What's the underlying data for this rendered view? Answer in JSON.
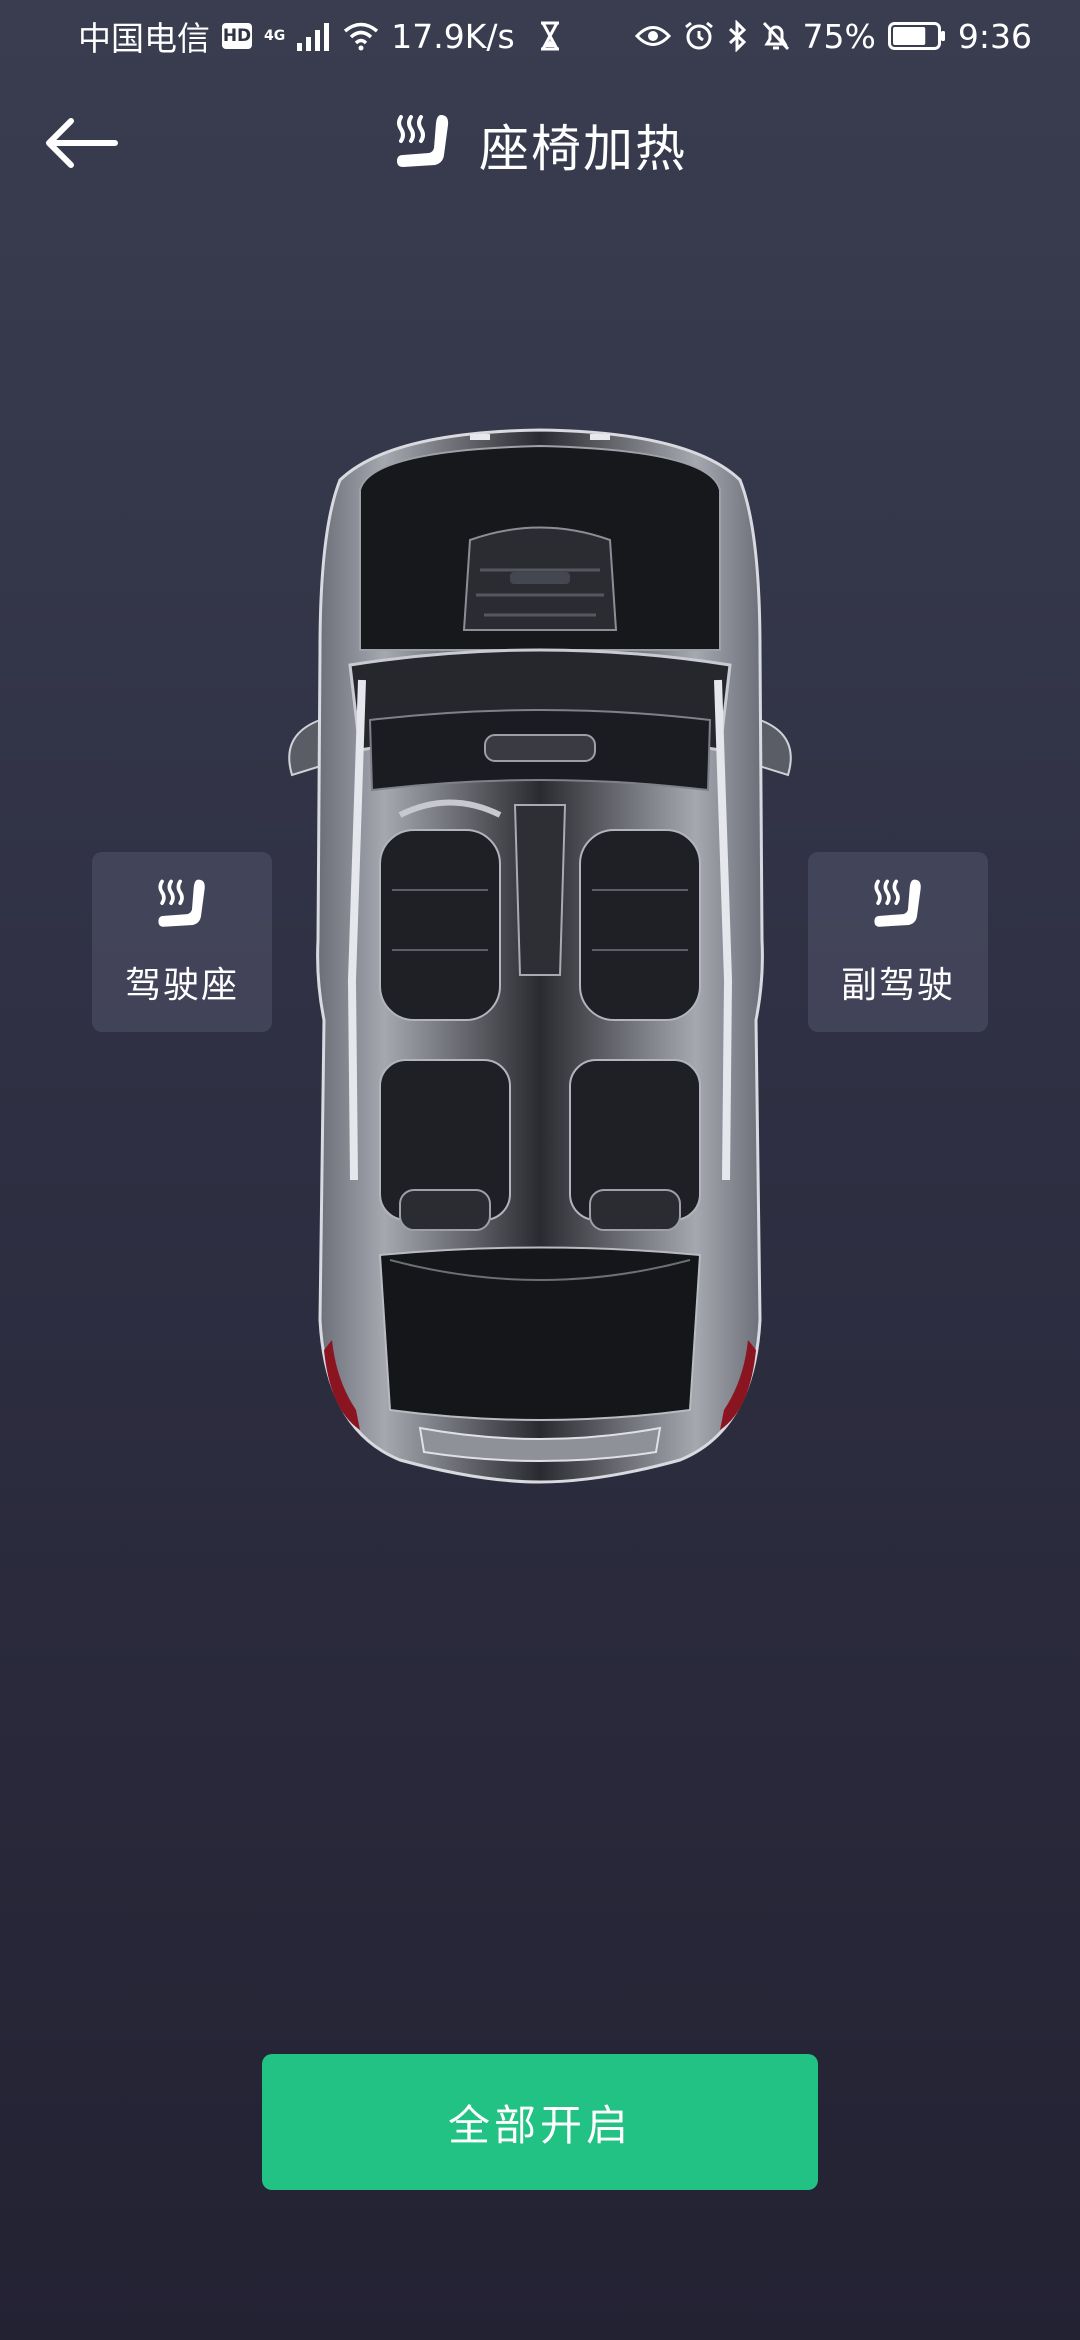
{
  "status_bar": {
    "carrier": "中国电信",
    "hd_badge": "HD",
    "network_type": "4G",
    "speed": "17.9K/s",
    "battery_percent": "75%",
    "time": "9:36",
    "battery_level": 0.75
  },
  "header": {
    "title": "座椅加热",
    "back_icon": "arrow-left-icon",
    "title_icon": "seat-heat-icon"
  },
  "seats": {
    "driver": {
      "label": "驾驶座",
      "icon": "seat-heat-icon"
    },
    "passenger": {
      "label": "副驾驶",
      "icon": "seat-heat-icon"
    }
  },
  "actions": {
    "all_on_label": "全部开启"
  },
  "colors": {
    "accent": "#21c283",
    "background_top": "#3a3d50",
    "background_bottom": "#232233",
    "seat_button_bg": "#4a4d60"
  }
}
